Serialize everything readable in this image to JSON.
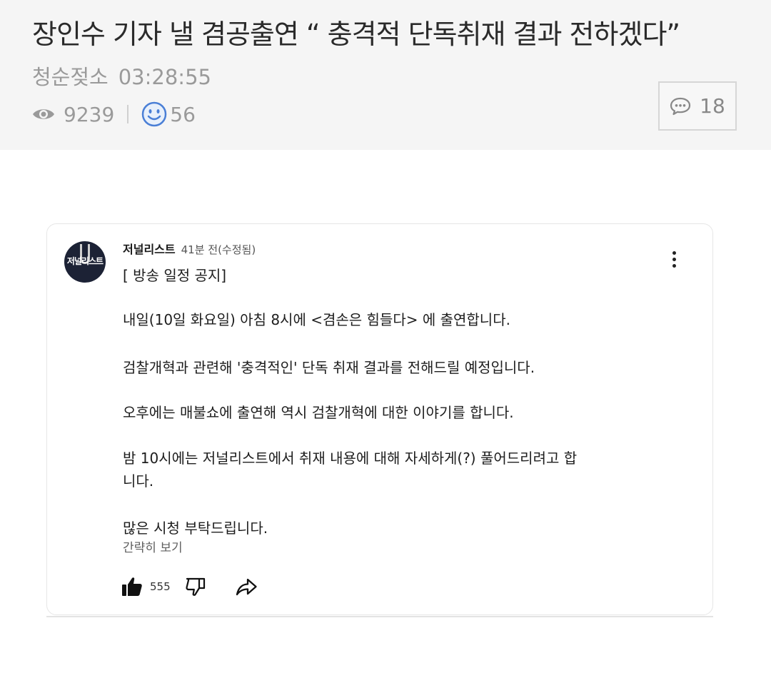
{
  "post": {
    "title": "장인수 기자 낼 겸공출연 “ 충격적 단독취재 결과 전하겠다”",
    "author": "청순젖소",
    "time": "03:28:55",
    "views": "9239",
    "likes": "56",
    "comment_count": "18"
  },
  "embedded_post": {
    "channel_name": "저널리스트",
    "channel_logo_text": "저널리스트",
    "timestamp": "41분 전(수정됨)",
    "lines": [
      "[ 방송 일정 공지]",
      "내일(10일 화요일) 아침 8시에 <겸손은 힘들다> 에 출연합니다.",
      "검찰개혁과 관련해 '충격적인' 단독 취재 결과를 전해드릴 예정입니다.",
      "오후에는 매불쇼에 출연해 역시 검찰개혁에 대한 이야기를 합니다.",
      "밤 10시에는 저널리스트에서 취재 내용에 대해 자세하게(?) 풀어드리려고 합",
      "니다.",
      "많은 시청 부탁드립니다."
    ],
    "collapse_label": "간략히 보기",
    "like_count": "555"
  },
  "icons": {
    "views": "eye-icon",
    "likes": "smile-icon",
    "comments": "comment-bubble-icon",
    "more": "more-vertical-icon",
    "like": "thumbs-up-icon",
    "dislike": "thumbs-down-icon",
    "share": "share-icon"
  },
  "colors": {
    "header_bg": "#f5f5f5",
    "smile_icon": "#4a7fd6",
    "avatar_bg": "#1c2235"
  }
}
